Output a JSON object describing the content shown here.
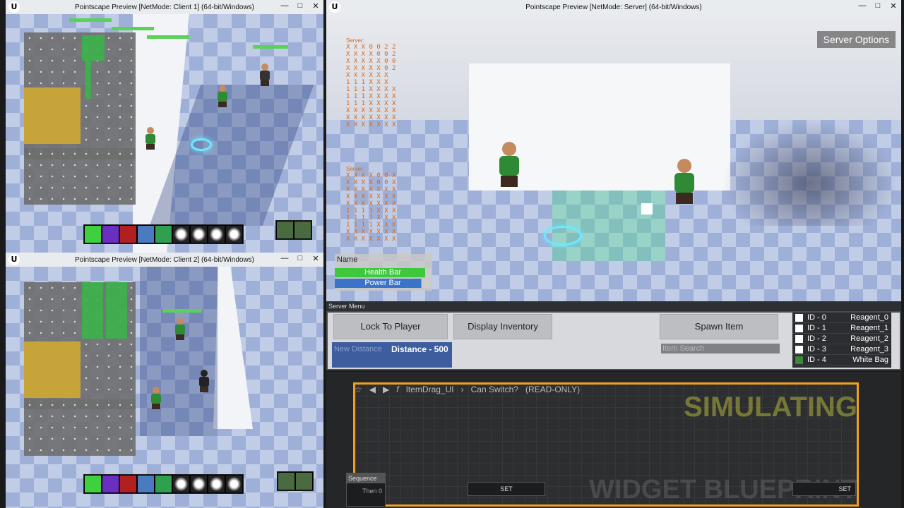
{
  "client1": {
    "title": "Pointscape Preview [NetMode: Client 1]  (64-bit/Windows)"
  },
  "client2": {
    "title": "Pointscape Preview [NetMode: Client 2]  (64-bit/Windows)"
  },
  "server": {
    "title": "Pointscape Preview [NetMode: Server]  (64-bit/Windows)",
    "options_label": "Server Options",
    "overlay_label_1": "Server:",
    "overlay_label_2": "Server:",
    "grid1": "X X X 0 0 2 2\nX X X X 0 0 2\nX X X X X 0 0\nX X X X X 0 2\nX X X X X X\n1 1 1 X X X\n1 1 1 X X X X\n1 1 1 X X X X\n1 1 1 X X X X\nX X X X X X X\nX X X X X X X\nX X X X X X X",
    "grid2": "X X X X 0 0 X\nX X X X 0 0 X\nX X X X X X X\nX X X X X X X\nX X X X X X X\n1 1 1 1 X X X\n1 1 1 1 X X X\n1 1 1 1 X X X\nX X X X X X X\nX X X X X X X",
    "name_label": "Name",
    "health_label": "Health Bar",
    "power_label": "Power Bar"
  },
  "server_menu": {
    "title": "Server Menu",
    "lock_label": "Lock To Player",
    "inventory_label": "Display Inventory",
    "spawn_label": "Spawn Item",
    "distance_placeholder": "New Distance",
    "distance_value": "Distance - 500",
    "search_placeholder": "Item Search",
    "items": [
      {
        "id": "ID - 0",
        "name": "Reagent_0"
      },
      {
        "id": "ID - 1",
        "name": "Reagent_1"
      },
      {
        "id": "ID - 2",
        "name": "Reagent_2"
      },
      {
        "id": "ID - 3",
        "name": "Reagent_3"
      },
      {
        "id": "ID - 4",
        "name": "White Bag"
      }
    ]
  },
  "blueprint": {
    "breadcrumb_1": "ItemDrag_UI",
    "breadcrumb_2": "Can Switch?",
    "readonly": "(READ-ONLY)",
    "simulating": "SIMULATING",
    "watermark": "WIDGET BLUEPRINT",
    "sequence_label": "Sequence",
    "then_label": "Then 0",
    "set_label_1": "SET",
    "set_label_2": "SET"
  }
}
